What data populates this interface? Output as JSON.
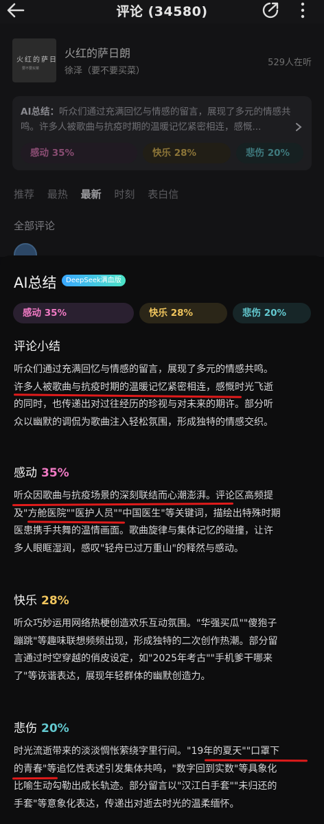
{
  "header": {
    "title": "评论 (34580)"
  },
  "song": {
    "cover_text": "火红的萨日朗",
    "cover_sub": "要不要买菜",
    "title": "火红的萨日朗",
    "artist": "徐泽（要不要买菜）",
    "online": "529人在听"
  },
  "ai_box": {
    "label": "AI总结：",
    "text": "听众们通过充满回忆与情感的留言，展现了多元的情感共鸣。许多人被歌曲与抗疫时期的温暖记忆紧密相连，感慨..."
  },
  "tabs": [
    "推荐",
    "最热",
    "最新",
    "时刻",
    "表白信"
  ],
  "active_tab": "最新",
  "all_comments": "全部评论",
  "sheet": {
    "title": "AI总结",
    "badge": "DeepSeek满血版",
    "emotions": [
      {
        "label": "感动 35%",
        "color": "#f07ac4"
      },
      {
        "label": "快乐 28%",
        "color": "#f0c55d"
      },
      {
        "label": "悲伤 20%",
        "color": "#63c8cf"
      }
    ],
    "summary": {
      "heading": "评论小结",
      "lines": [
        "听众们通过充满回忆与情感的留言，展现了多元的情感共鸣。",
        "许多人被歌曲与抗疫时期的温暖记忆紧密相连，感慨时光飞逝",
        "的同时，也传递出对过往经历的珍视与对未来的期许。部分听",
        "众以幽默的调侃为歌曲注入轻松氛围，形成独特的情感交织。"
      ]
    },
    "moved": {
      "name": "感动",
      "pct": "35%",
      "lines": [
        "听众因歌曲与抗疫场景的深刻联结而心潮澎湃。评论区高频提",
        "及\"方舱医院\"\"医护人员\"\"中国医生\"等关键词，描绘出特殊时期",
        "医患携手共舞的温情画面。歌曲旋律与集体记忆的碰撞，让许",
        "多人眼眶湿润，感叹\"轻舟已过万重山\"的释然与感动。"
      ]
    },
    "happy": {
      "name": "快乐",
      "pct": "28%",
      "lines": [
        "听众巧妙运用网络热梗创造欢乐互动氛围。\"华强买瓜\"\"傻狍子",
        "蹦跳\"等趣味联想频频出现，形成独特的二次创作热潮。部分留",
        "言通过时空穿越的俏皮设定，如\"2025年考古\"\"手机爹干哪来",
        "了\"等诙谐表达，展现年轻群体的幽默创造力。"
      ]
    },
    "sad": {
      "name": "悲伤",
      "pct": "20%",
      "lines": [
        "时光流逝带来的淡淡惆怅萦绕字里行间。\"19年的夏天\"\"口罩下",
        "的青春\"等追忆性表述引发集体共鸣，\"数字回到实数\"等具象化",
        "比喻生动勾勒出成长轨迹。部分留言以\"汉江白手套\"\"未归还的",
        "手套\"等意象化表达，传递出对逝去时光的温柔缅怀。"
      ]
    }
  }
}
